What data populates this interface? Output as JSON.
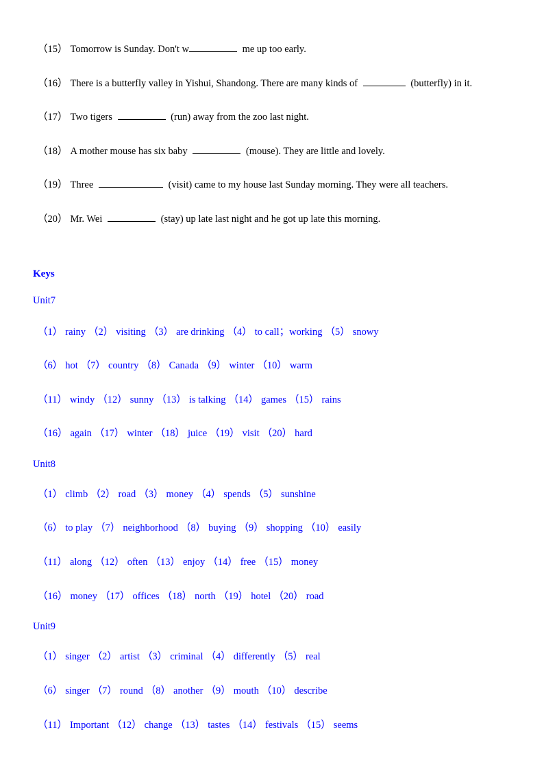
{
  "questions": [
    {
      "num": "（15）",
      "before": "Tomorrow is Sunday. Don't w",
      "hint": "",
      "after": " me up too early.",
      "blank_w": 70,
      "tight": true
    },
    {
      "num": "（16）",
      "before": "There is a butterfly valley in Yishui, Shandong. There are many kinds of ",
      "hint": "(butterfly)",
      "after": " in it.",
      "blank_w": 62
    },
    {
      "num": "（17）",
      "before": "Two tigers ",
      "hint": "(run)",
      "after": " away from the zoo last night.",
      "blank_w": 70
    },
    {
      "num": "（18）",
      "before": "A mother mouse has six baby ",
      "hint": "(mouse)",
      "after": ". They are little and lovely.",
      "blank_w": 70
    },
    {
      "num": "（19）",
      "before": "Three ",
      "hint": "(visit)",
      "after": " came to my house last Sunday morning. They were all teachers.",
      "blank_w": 94
    },
    {
      "num": "（20）",
      "before": "Mr. Wei ",
      "hint": "(stay)",
      "after": " up late last night and he got up late this morning.",
      "blank_w": 70
    }
  ],
  "keys": {
    "heading": "Keys",
    "units": [
      {
        "title": "Unit7",
        "rows": [
          [
            [
              "（1）",
              "rainy"
            ],
            [
              "（2）",
              "visiting"
            ],
            [
              "（3）",
              "are drinking"
            ],
            [
              "（4）",
              "to call；working"
            ],
            [
              "（5）",
              "snowy"
            ]
          ],
          [
            [
              "（6）",
              "hot"
            ],
            [
              "（7）",
              "country"
            ],
            [
              "（8）",
              "Canada"
            ],
            [
              "（9）",
              "winter"
            ],
            [
              "（10）",
              "warm"
            ]
          ],
          [
            [
              "（11）",
              "windy"
            ],
            [
              "（12）",
              "sunny"
            ],
            [
              "（13）",
              "is talking"
            ],
            [
              "（14）",
              "games"
            ],
            [
              "（15）",
              "rains"
            ]
          ],
          [
            [
              "（16）",
              "again"
            ],
            [
              "（17）",
              "winter"
            ],
            [
              "（18）",
              "juice"
            ],
            [
              "（19）",
              "visit"
            ],
            [
              "（20）",
              "hard"
            ]
          ]
        ]
      },
      {
        "title": "Unit8",
        "rows": [
          [
            [
              "（1）",
              "climb"
            ],
            [
              "（2）",
              "road"
            ],
            [
              "（3）",
              "money"
            ],
            [
              "（4）",
              "spends"
            ],
            [
              "（5）",
              "sunshine"
            ]
          ],
          [
            [
              "（6）",
              "to play"
            ],
            [
              "（7）",
              "neighborhood"
            ],
            [
              "（8）",
              "buying"
            ],
            [
              "（9）",
              "shopping"
            ],
            [
              "（10）",
              "easily"
            ]
          ],
          [
            [
              "（11）",
              "along"
            ],
            [
              "（12）",
              "often"
            ],
            [
              "（13）",
              "enjoy"
            ],
            [
              "（14）",
              "free"
            ],
            [
              "（15）",
              "money"
            ]
          ],
          [
            [
              "（16）",
              "money"
            ],
            [
              "（17）",
              "offices"
            ],
            [
              "（18）",
              "north"
            ],
            [
              "（19）",
              "hotel"
            ],
            [
              "（20）",
              "road"
            ]
          ]
        ]
      },
      {
        "title": "Unit9",
        "rows": [
          [
            [
              "（1）",
              "singer"
            ],
            [
              "（2）",
              "artist"
            ],
            [
              "（3）",
              "criminal"
            ],
            [
              "（4）",
              "differently"
            ],
            [
              "（5）",
              "real"
            ]
          ],
          [
            [
              "（6）",
              "singer"
            ],
            [
              "（7）",
              "round"
            ],
            [
              "（8）",
              "another"
            ],
            [
              "（9）",
              "mouth"
            ],
            [
              "（10）",
              "describe"
            ]
          ],
          [
            [
              "（11）",
              "Important"
            ],
            [
              "（12）",
              "change"
            ],
            [
              "（13）",
              "tastes"
            ],
            [
              "（14）",
              "festivals"
            ],
            [
              "（15）",
              "seems"
            ]
          ]
        ]
      }
    ]
  }
}
